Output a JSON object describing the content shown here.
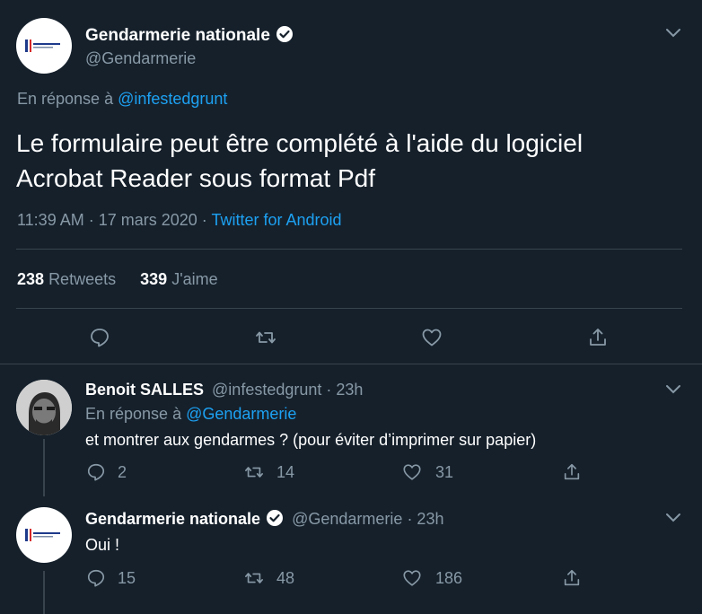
{
  "main_tweet": {
    "display_name": "Gendarmerie nationale",
    "handle": "@Gendarmerie",
    "reply_prefix": "En réponse à",
    "reply_to": "@infestedgrunt",
    "text_line1": "Le formulaire peut être complété à l'aide du logiciel",
    "text_line2": "Acrobat Reader sous format Pdf",
    "timestamp": "11:39 AM · 17 mars 2020",
    "dot": "·",
    "source": "Twitter for Android",
    "retweets_count": "238",
    "retweets_label": "Retweets",
    "likes_count": "339",
    "likes_label": "J'aime"
  },
  "replies": [
    {
      "display_name": "Benoit SALLES",
      "handle": "@infestedgrunt",
      "time": "· 23h",
      "reply_prefix": "En réponse à",
      "reply_to": "@Gendarmerie",
      "text": "et montrer aux gendarmes ? (pour éviter d’imprimer sur papier)",
      "reply_count": "2",
      "retweet_count": "14",
      "like_count": "31"
    },
    {
      "display_name": "Gendarmerie nationale",
      "handle": "@Gendarmerie",
      "time": "· 23h",
      "text": "Oui !",
      "reply_count": "15",
      "retweet_count": "48",
      "like_count": "186"
    }
  ],
  "icons": {
    "reply": "reply-icon",
    "retweet": "retweet-icon",
    "like": "heart-icon",
    "share": "share-icon",
    "verified": "verified-badge-icon",
    "more": "chevron-down-icon"
  },
  "colors": {
    "background": "#15202b",
    "text": "#ffffff",
    "muted": "#8899a6",
    "link": "#1da1f2",
    "divider": "#38444d"
  }
}
